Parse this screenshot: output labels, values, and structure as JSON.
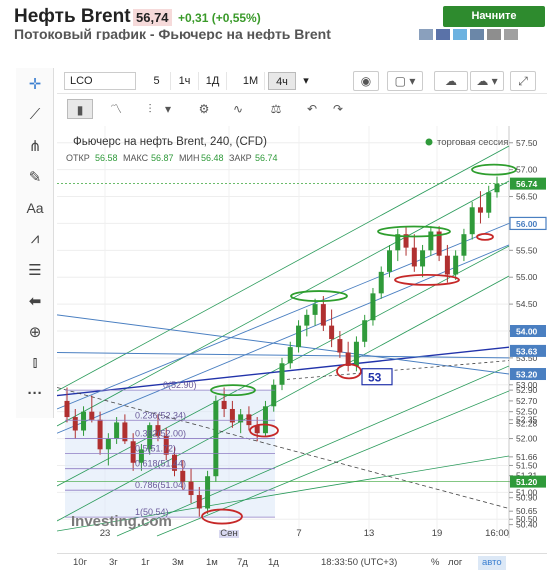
{
  "header": {
    "title": "Нефть Brent",
    "price": "56,74",
    "change": "+0,31 (+0,55%)",
    "trade_button": "Начните торговать",
    "subtitle": "Потоковый график - Фьючерс на нефть Brent"
  },
  "toolbar": {
    "symbol": "LCO",
    "timeframes": [
      "5",
      "1ч",
      "1Д",
      "1М",
      "4ч"
    ],
    "selected_timeframe": "4ч",
    "chart_icons": [
      "camera-icon",
      "color-box-icon",
      "cloud-upload-icon",
      "cloud-download-icon"
    ]
  },
  "toolbar2": {
    "icons": [
      "candles-icon",
      "line-chart-icon",
      "bars-icon",
      "gear-icon",
      "indicators-icon",
      "scales-icon",
      "undo-icon",
      "redo-icon"
    ]
  },
  "left_tools": [
    "crosshair-icon",
    "trendline-icon",
    "pitchfork-icon",
    "brush-icon",
    "text-icon",
    "pattern-icon",
    "fib-icon",
    "back-arrow-icon",
    "zoom-icon",
    "bars-measure-icon",
    "more-icon"
  ],
  "chart": {
    "title": "Фьючерс на нефть Brent, 240, (CFD)",
    "session_label": "торговая сессия",
    "ohlc": {
      "otkr_label": "ОТКР",
      "otkr": "56.58",
      "maks_label": "МАКС",
      "maks": "56.87",
      "min_label": "МИН",
      "min": "56.48",
      "zakr_label": "ЗАКР",
      "zakr": "56.74"
    },
    "price_ticks": [
      "57.50",
      "57.00",
      "56.50",
      "56.00",
      "55.50",
      "55.00",
      "54.50",
      "54.00",
      "53.50",
      "53.00",
      "52.90",
      "52.70",
      "52.50",
      "52.35",
      "52.28",
      "52.00",
      "51.66",
      "51.50",
      "51.31",
      "51.20",
      "51.00",
      "50.90",
      "50.65",
      "50.50",
      "50.40"
    ],
    "current_price": "56.74",
    "marked_price": "56.00",
    "box_price_a": "54.00",
    "box_price_b": "53.63",
    "box_price_c": "53.20",
    "box_price_d": "51.20",
    "annotation_53": "53",
    "fib_levels": [
      {
        "label": "0(52.90)",
        "value": 52.9
      },
      {
        "label": "0.236(52.34)",
        "value": 52.34
      },
      {
        "label": "0.382(52.00)",
        "value": 52.0
      },
      {
        "label": "0.5(51.72)",
        "value": 51.72
      },
      {
        "label": "0.618(51.44)",
        "value": 51.44
      },
      {
        "label": "0.786(51.04)",
        "value": 51.04
      },
      {
        "label": "1(50.54)",
        "value": 50.54
      }
    ],
    "x_labels": [
      "23",
      "Сен",
      "7",
      "13",
      "19",
      "16:00"
    ],
    "watermark": "Investing.com",
    "colors": {
      "up": "#2f9a3a",
      "down": "#b03030",
      "fib": "#8e7cc3",
      "channel": "#4a7fc1",
      "green_line": "#2b9b5b",
      "red_ellipse": "#c62828",
      "green_ellipse": "#2e9e2e",
      "blue_line": "#2233aa"
    }
  },
  "chart_data": {
    "type": "candlestick",
    "title": "Фьючерс на нефть Brent, 240, (CFD)",
    "ylim": [
      50.3,
      57.7
    ],
    "x_categories": [
      "23",
      "Сен",
      "7",
      "13",
      "19",
      "16:00"
    ],
    "last_close": 56.74,
    "candles": [
      [
        52.7,
        52.95,
        52.3,
        52.4
      ],
      [
        52.4,
        52.55,
        52.0,
        52.15
      ],
      [
        52.15,
        52.6,
        52.05,
        52.5
      ],
      [
        52.5,
        52.8,
        52.3,
        52.35
      ],
      [
        52.35,
        52.5,
        51.7,
        51.8
      ],
      [
        51.8,
        52.1,
        51.5,
        52.0
      ],
      [
        52.0,
        52.4,
        51.9,
        52.3
      ],
      [
        52.3,
        52.45,
        51.9,
        51.95
      ],
      [
        51.95,
        52.1,
        51.4,
        51.55
      ],
      [
        51.55,
        51.9,
        51.4,
        51.8
      ],
      [
        51.8,
        52.3,
        51.7,
        52.25
      ],
      [
        52.25,
        52.45,
        51.95,
        52.05
      ],
      [
        52.05,
        52.2,
        51.6,
        51.7
      ],
      [
        51.7,
        51.85,
        51.3,
        51.4
      ],
      [
        51.4,
        51.6,
        51.05,
        51.2
      ],
      [
        51.2,
        51.45,
        50.8,
        50.95
      ],
      [
        50.95,
        51.1,
        50.55,
        50.7
      ],
      [
        50.7,
        51.4,
        50.6,
        51.3
      ],
      [
        51.3,
        52.8,
        51.2,
        52.7
      ],
      [
        52.7,
        52.95,
        52.4,
        52.55
      ],
      [
        52.55,
        52.7,
        52.2,
        52.3
      ],
      [
        52.3,
        52.55,
        52.1,
        52.45
      ],
      [
        52.45,
        52.6,
        52.15,
        52.25
      ],
      [
        52.25,
        52.4,
        51.95,
        52.1
      ],
      [
        52.1,
        52.7,
        52.05,
        52.6
      ],
      [
        52.6,
        53.1,
        52.5,
        53.0
      ],
      [
        53.0,
        53.5,
        52.9,
        53.4
      ],
      [
        53.4,
        53.8,
        53.3,
        53.7
      ],
      [
        53.7,
        54.2,
        53.6,
        54.1
      ],
      [
        54.1,
        54.4,
        53.9,
        54.3
      ],
      [
        54.3,
        54.6,
        54.1,
        54.5
      ],
      [
        54.5,
        54.65,
        54.0,
        54.1
      ],
      [
        54.1,
        54.4,
        53.7,
        53.85
      ],
      [
        53.85,
        54.0,
        53.5,
        53.6
      ],
      [
        53.6,
        53.8,
        53.25,
        53.35
      ],
      [
        53.35,
        53.9,
        53.25,
        53.8
      ],
      [
        53.8,
        54.3,
        53.7,
        54.2
      ],
      [
        54.2,
        54.8,
        54.1,
        54.7
      ],
      [
        54.7,
        55.2,
        54.6,
        55.1
      ],
      [
        55.1,
        55.6,
        55.0,
        55.5
      ],
      [
        55.5,
        55.9,
        55.3,
        55.8
      ],
      [
        55.8,
        55.95,
        55.4,
        55.55
      ],
      [
        55.55,
        55.8,
        55.1,
        55.2
      ],
      [
        55.2,
        55.6,
        55.0,
        55.5
      ],
      [
        55.5,
        55.95,
        55.4,
        55.85
      ],
      [
        55.85,
        55.95,
        55.3,
        55.4
      ],
      [
        55.4,
        55.6,
        54.9,
        55.05
      ],
      [
        55.05,
        55.5,
        54.95,
        55.4
      ],
      [
        55.4,
        55.9,
        55.3,
        55.8
      ],
      [
        55.8,
        56.4,
        55.7,
        56.3
      ],
      [
        56.3,
        56.6,
        56.0,
        56.2
      ],
      [
        56.2,
        56.7,
        56.1,
        56.58
      ],
      [
        56.58,
        56.87,
        56.48,
        56.74
      ]
    ]
  },
  "bottom_bar": {
    "ranges": [
      "10г",
      "3г",
      "1г",
      "3м",
      "1м",
      "7д",
      "1д"
    ],
    "time": "18:33:50 (UTC+3)",
    "pct": "%",
    "log": "лог",
    "auto": "авто"
  }
}
